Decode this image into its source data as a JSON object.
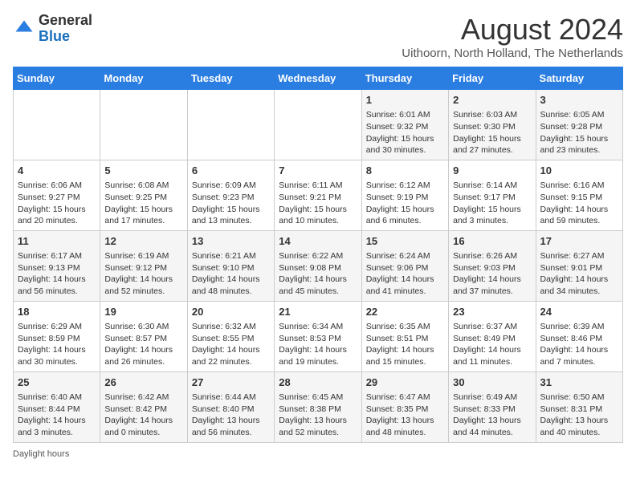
{
  "header": {
    "logo_general": "General",
    "logo_blue": "Blue",
    "title": "August 2024",
    "subtitle": "Uithoorn, North Holland, The Netherlands"
  },
  "days_of_week": [
    "Sunday",
    "Monday",
    "Tuesday",
    "Wednesday",
    "Thursday",
    "Friday",
    "Saturday"
  ],
  "weeks": [
    [
      {
        "day": "",
        "sunrise": "",
        "sunset": "",
        "daylight": ""
      },
      {
        "day": "",
        "sunrise": "",
        "sunset": "",
        "daylight": ""
      },
      {
        "day": "",
        "sunrise": "",
        "sunset": "",
        "daylight": ""
      },
      {
        "day": "",
        "sunrise": "",
        "sunset": "",
        "daylight": ""
      },
      {
        "day": "1",
        "sunrise": "Sunrise: 6:01 AM",
        "sunset": "Sunset: 9:32 PM",
        "daylight": "Daylight: 15 hours and 30 minutes."
      },
      {
        "day": "2",
        "sunrise": "Sunrise: 6:03 AM",
        "sunset": "Sunset: 9:30 PM",
        "daylight": "Daylight: 15 hours and 27 minutes."
      },
      {
        "day": "3",
        "sunrise": "Sunrise: 6:05 AM",
        "sunset": "Sunset: 9:28 PM",
        "daylight": "Daylight: 15 hours and 23 minutes."
      }
    ],
    [
      {
        "day": "4",
        "sunrise": "Sunrise: 6:06 AM",
        "sunset": "Sunset: 9:27 PM",
        "daylight": "Daylight: 15 hours and 20 minutes."
      },
      {
        "day": "5",
        "sunrise": "Sunrise: 6:08 AM",
        "sunset": "Sunset: 9:25 PM",
        "daylight": "Daylight: 15 hours and 17 minutes."
      },
      {
        "day": "6",
        "sunrise": "Sunrise: 6:09 AM",
        "sunset": "Sunset: 9:23 PM",
        "daylight": "Daylight: 15 hours and 13 minutes."
      },
      {
        "day": "7",
        "sunrise": "Sunrise: 6:11 AM",
        "sunset": "Sunset: 9:21 PM",
        "daylight": "Daylight: 15 hours and 10 minutes."
      },
      {
        "day": "8",
        "sunrise": "Sunrise: 6:12 AM",
        "sunset": "Sunset: 9:19 PM",
        "daylight": "Daylight: 15 hours and 6 minutes."
      },
      {
        "day": "9",
        "sunrise": "Sunrise: 6:14 AM",
        "sunset": "Sunset: 9:17 PM",
        "daylight": "Daylight: 15 hours and 3 minutes."
      },
      {
        "day": "10",
        "sunrise": "Sunrise: 6:16 AM",
        "sunset": "Sunset: 9:15 PM",
        "daylight": "Daylight: 14 hours and 59 minutes."
      }
    ],
    [
      {
        "day": "11",
        "sunrise": "Sunrise: 6:17 AM",
        "sunset": "Sunset: 9:13 PM",
        "daylight": "Daylight: 14 hours and 56 minutes."
      },
      {
        "day": "12",
        "sunrise": "Sunrise: 6:19 AM",
        "sunset": "Sunset: 9:12 PM",
        "daylight": "Daylight: 14 hours and 52 minutes."
      },
      {
        "day": "13",
        "sunrise": "Sunrise: 6:21 AM",
        "sunset": "Sunset: 9:10 PM",
        "daylight": "Daylight: 14 hours and 48 minutes."
      },
      {
        "day": "14",
        "sunrise": "Sunrise: 6:22 AM",
        "sunset": "Sunset: 9:08 PM",
        "daylight": "Daylight: 14 hours and 45 minutes."
      },
      {
        "day": "15",
        "sunrise": "Sunrise: 6:24 AM",
        "sunset": "Sunset: 9:06 PM",
        "daylight": "Daylight: 14 hours and 41 minutes."
      },
      {
        "day": "16",
        "sunrise": "Sunrise: 6:26 AM",
        "sunset": "Sunset: 9:03 PM",
        "daylight": "Daylight: 14 hours and 37 minutes."
      },
      {
        "day": "17",
        "sunrise": "Sunrise: 6:27 AM",
        "sunset": "Sunset: 9:01 PM",
        "daylight": "Daylight: 14 hours and 34 minutes."
      }
    ],
    [
      {
        "day": "18",
        "sunrise": "Sunrise: 6:29 AM",
        "sunset": "Sunset: 8:59 PM",
        "daylight": "Daylight: 14 hours and 30 minutes."
      },
      {
        "day": "19",
        "sunrise": "Sunrise: 6:30 AM",
        "sunset": "Sunset: 8:57 PM",
        "daylight": "Daylight: 14 hours and 26 minutes."
      },
      {
        "day": "20",
        "sunrise": "Sunrise: 6:32 AM",
        "sunset": "Sunset: 8:55 PM",
        "daylight": "Daylight: 14 hours and 22 minutes."
      },
      {
        "day": "21",
        "sunrise": "Sunrise: 6:34 AM",
        "sunset": "Sunset: 8:53 PM",
        "daylight": "Daylight: 14 hours and 19 minutes."
      },
      {
        "day": "22",
        "sunrise": "Sunrise: 6:35 AM",
        "sunset": "Sunset: 8:51 PM",
        "daylight": "Daylight: 14 hours and 15 minutes."
      },
      {
        "day": "23",
        "sunrise": "Sunrise: 6:37 AM",
        "sunset": "Sunset: 8:49 PM",
        "daylight": "Daylight: 14 hours and 11 minutes."
      },
      {
        "day": "24",
        "sunrise": "Sunrise: 6:39 AM",
        "sunset": "Sunset: 8:46 PM",
        "daylight": "Daylight: 14 hours and 7 minutes."
      }
    ],
    [
      {
        "day": "25",
        "sunrise": "Sunrise: 6:40 AM",
        "sunset": "Sunset: 8:44 PM",
        "daylight": "Daylight: 14 hours and 3 minutes."
      },
      {
        "day": "26",
        "sunrise": "Sunrise: 6:42 AM",
        "sunset": "Sunset: 8:42 PM",
        "daylight": "Daylight: 14 hours and 0 minutes."
      },
      {
        "day": "27",
        "sunrise": "Sunrise: 6:44 AM",
        "sunset": "Sunset: 8:40 PM",
        "daylight": "Daylight: 13 hours and 56 minutes."
      },
      {
        "day": "28",
        "sunrise": "Sunrise: 6:45 AM",
        "sunset": "Sunset: 8:38 PM",
        "daylight": "Daylight: 13 hours and 52 minutes."
      },
      {
        "day": "29",
        "sunrise": "Sunrise: 6:47 AM",
        "sunset": "Sunset: 8:35 PM",
        "daylight": "Daylight: 13 hours and 48 minutes."
      },
      {
        "day": "30",
        "sunrise": "Sunrise: 6:49 AM",
        "sunset": "Sunset: 8:33 PM",
        "daylight": "Daylight: 13 hours and 44 minutes."
      },
      {
        "day": "31",
        "sunrise": "Sunrise: 6:50 AM",
        "sunset": "Sunset: 8:31 PM",
        "daylight": "Daylight: 13 hours and 40 minutes."
      }
    ]
  ],
  "footer": {
    "daylight_label": "Daylight hours"
  }
}
